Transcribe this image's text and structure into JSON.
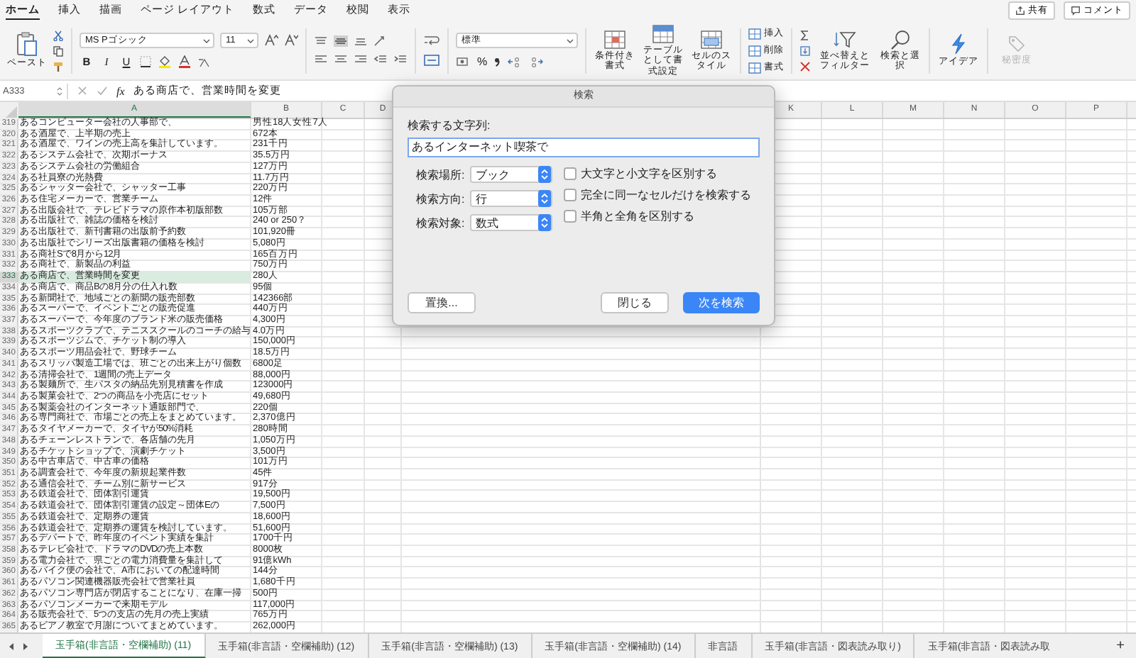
{
  "ribbon_tabs": [
    {
      "label": "ホーム",
      "selected": true
    },
    {
      "label": "挿入",
      "selected": false
    },
    {
      "label": "描画",
      "selected": false
    },
    {
      "label": "ページ レイアウト",
      "selected": false
    },
    {
      "label": "数式",
      "selected": false
    },
    {
      "label": "データ",
      "selected": false
    },
    {
      "label": "校閲",
      "selected": false
    },
    {
      "label": "表示",
      "selected": false
    }
  ],
  "share_button": "共有",
  "comment_button": "コメント",
  "ribbon": {
    "paste": "ペースト",
    "font_name": "MS Pゴシック",
    "font_size": "11",
    "bold": "B",
    "italic": "I",
    "underline": "U",
    "number_format": "標準",
    "percent": "%",
    "styles": [
      "条件付き書式",
      "テーブルとして書式設定",
      "セルのスタイル"
    ],
    "cells": [
      "挿入",
      "削除",
      "書式"
    ],
    "sort_filter": "並べ替えとフィルター",
    "find_select": "検索と選択",
    "ideas": "アイデア",
    "sensitivity": {
      "label": "秘密度",
      "disabled": true
    }
  },
  "formula_bar": {
    "name_box": "A333",
    "fx": "fx",
    "formula": "ある商店で、営業時間を変更"
  },
  "columns": [
    {
      "label": "A",
      "selected": true
    },
    {
      "label": "B",
      "selected": false
    },
    {
      "label": "C",
      "selected": false
    },
    {
      "label": "D",
      "selected": false
    },
    {
      "label": "K",
      "selected": false
    },
    {
      "label": "L",
      "selected": false
    },
    {
      "label": "M",
      "selected": false
    },
    {
      "label": "N",
      "selected": false
    },
    {
      "label": "O",
      "selected": false
    },
    {
      "label": "P",
      "selected": false
    }
  ],
  "rows": [
    {
      "number": "319",
      "a": "あるコンピューター会社の人事部で、",
      "b": "男性18人女性7人",
      "selected": false
    },
    {
      "number": "320",
      "a": "ある酒屋で、上半期の売上",
      "b": "672本",
      "selected": false
    },
    {
      "number": "321",
      "a": "ある酒屋で、ワインの売上高を集計しています。",
      "b": "231千円",
      "selected": false
    },
    {
      "number": "322",
      "a": "あるシステム会社で、次期ボーナス",
      "b": "35.5万円",
      "selected": false
    },
    {
      "number": "323",
      "a": "あるシステム会社の労働組合",
      "b": "127万円",
      "selected": false
    },
    {
      "number": "324",
      "a": "ある社員寮の光熱費",
      "b": "11.7万円",
      "selected": false
    },
    {
      "number": "325",
      "a": "あるシャッター会社で、シャッター工事",
      "b": "220万円",
      "selected": false
    },
    {
      "number": "326",
      "a": "ある住宅メーカーで、営業チーム",
      "b": "12件",
      "selected": false
    },
    {
      "number": "327",
      "a": "ある出版会社で、テレビドラマの原作本初版部数",
      "b": "105万部",
      "selected": false
    },
    {
      "number": "328",
      "a": "ある出版社で、雑誌の価格を検討",
      "b": "240 or 250？",
      "selected": false
    },
    {
      "number": "329",
      "a": "ある出版社で、新刊書籍の出版前予約数",
      "b": "101,920冊",
      "selected": false
    },
    {
      "number": "330",
      "a": "ある出版社でシリーズ出版書籍の価格を検討",
      "b": "5,080円",
      "selected": false
    },
    {
      "number": "331",
      "a": "ある商社Sで8月から12月",
      "b": "165百万円",
      "selected": false
    },
    {
      "number": "332",
      "a": "ある商社で、新製品の利益",
      "b": "750万円",
      "selected": false
    },
    {
      "number": "333",
      "a": "ある商店で、営業時間を変更",
      "b": "280人",
      "selected": true
    },
    {
      "number": "334",
      "a": "ある商店で、商品Bの8月分の仕入れ数",
      "b": "95個",
      "selected": false
    },
    {
      "number": "335",
      "a": "ある新聞社で、地域ごとの新聞の販売部数",
      "b": "142366部",
      "selected": false
    },
    {
      "number": "336",
      "a": "あるスーパーで、イベントごとの販売促進",
      "b": "440万円",
      "selected": false
    },
    {
      "number": "337",
      "a": "あるスーパーで、今年度のブランド米の販売価格",
      "b": "4,300円",
      "selected": false
    },
    {
      "number": "338",
      "a": "あるスポーツクラブで、テニススクールのコーチの給与",
      "b": "4.0万円",
      "selected": false
    },
    {
      "number": "339",
      "a": "あるスポーツジムで、チケット制の導入",
      "b": "150,000円",
      "selected": false
    },
    {
      "number": "340",
      "a": "あるスポーツ用品会社で、野球チーム",
      "b": "18.5万円",
      "selected": false
    },
    {
      "number": "341",
      "a": "あるスリッパ製造工場では、班ごとの出来上がり個数",
      "b": "6800足",
      "selected": false
    },
    {
      "number": "342",
      "a": "ある清掃会社で、1週間の売上データ",
      "b": "88,000円",
      "selected": false
    },
    {
      "number": "343",
      "a": "ある製麺所で、生パスタの納品先別見積書を作成",
      "b": "123000円",
      "selected": false
    },
    {
      "number": "344",
      "a": "ある製菓会社で、2つの商品を小売店にセット",
      "b": "49,680円",
      "selected": false
    },
    {
      "number": "345",
      "a": "ある製薬会社のインターネット通販部門で、",
      "b": "220個",
      "selected": false
    },
    {
      "number": "346",
      "a": "ある専門商社で、市場ごとの売上をまとめています。",
      "b": "2,370億円",
      "selected": false
    },
    {
      "number": "347",
      "a": "あるタイヤメーカーで、タイヤが50%消耗",
      "b": "280時間",
      "selected": false
    },
    {
      "number": "348",
      "a": "あるチェーンレストランで、各店舗の先月",
      "b": "1,050万円",
      "selected": false
    },
    {
      "number": "349",
      "a": "あるチケットショップで、演劇チケット",
      "b": "3,500円",
      "selected": false
    },
    {
      "number": "350",
      "a": "ある中古車店で、中古車の価格",
      "b": "101万円",
      "selected": false
    },
    {
      "number": "351",
      "a": "ある調査会社で、今年度の新規起業件数",
      "b": "45件",
      "selected": false
    },
    {
      "number": "352",
      "a": "ある通信会社で、チーム別に新サービス",
      "b": "917分",
      "selected": false
    },
    {
      "number": "353",
      "a": "ある鉄道会社で、団体割引運賃",
      "b": "19,500円",
      "selected": false
    },
    {
      "number": "354",
      "a": "ある鉄道会社で、団体割引運賃の設定～団体Eの",
      "b": "7,500円",
      "selected": false
    },
    {
      "number": "355",
      "a": "ある鉄道会社で、定期券の運賃",
      "b": "18,600円",
      "selected": false
    },
    {
      "number": "356",
      "a": "ある鉄道会社で、定期券の運賃を検討しています。",
      "b": "51,600円",
      "selected": false
    },
    {
      "number": "357",
      "a": "あるデパートで、昨年度のイベント実績を集計",
      "b": "1700千円",
      "selected": false
    },
    {
      "number": "358",
      "a": "あるテレビ会社で、ドラマのDVDの売上本数",
      "b": "8000枚",
      "selected": false
    },
    {
      "number": "359",
      "a": "ある電力会社で、県ごとの電力消費量を集計して",
      "b": "91億kWh",
      "selected": false
    },
    {
      "number": "360",
      "a": "あるバイク便の会社で、A市においての配達時間",
      "b": "144分",
      "selected": false
    },
    {
      "number": "361",
      "a": "あるパソコン関連機器販売会社で営業社員",
      "b": "1,680千円",
      "selected": false
    },
    {
      "number": "362",
      "a": "あるパソコン専門店が閉店することになり、在庫一掃",
      "b": "500円",
      "selected": false
    },
    {
      "number": "363",
      "a": "あるパソコンメーカーで来期モデル",
      "b": "117,000円",
      "selected": false
    },
    {
      "number": "364",
      "a": "ある販売会社で、5つの支店の先月の売上実績",
      "b": "765万円",
      "selected": false
    },
    {
      "number": "365",
      "a": "あるピアノ教室で月謝についてまとめています。",
      "b": "262,000円",
      "selected": false
    }
  ],
  "dialog": {
    "title": "検索",
    "find_label": "検索する文字列:",
    "find_value": "あるインターネット喫茶で",
    "options": [
      {
        "label": "検索場所:",
        "value": "ブック"
      },
      {
        "label": "検索方向:",
        "value": "行"
      },
      {
        "label": "検索対象:",
        "value": "数式"
      }
    ],
    "checkboxes": [
      {
        "label": "大文字と小文字を区別する",
        "checked": false
      },
      {
        "label": "完全に同一なセルだけを検索する",
        "checked": false
      },
      {
        "label": "半角と全角を区別する",
        "checked": false
      }
    ],
    "buttons": [
      {
        "label": "置換...",
        "kind": "plain"
      },
      {
        "label": "閉じる",
        "kind": "plain"
      },
      {
        "label": "次を検索",
        "kind": "default"
      }
    ]
  },
  "sheet_tabs": [
    {
      "label": "玉手箱(非言語・空欄補助) (11)",
      "selected": true
    },
    {
      "label": "玉手箱(非言語・空欄補助) (12)",
      "selected": false
    },
    {
      "label": "玉手箱(非言語・空欄補助) (13)",
      "selected": false
    },
    {
      "label": "玉手箱(非言語・空欄補助) (14)",
      "selected": false
    },
    {
      "label": "非言語",
      "selected": false
    },
    {
      "label": "玉手箱(非言語・図表読み取り)",
      "selected": false
    },
    {
      "label": "玉手箱(非言語・図表読み取",
      "selected": false
    }
  ],
  "add_sheet": "+"
}
